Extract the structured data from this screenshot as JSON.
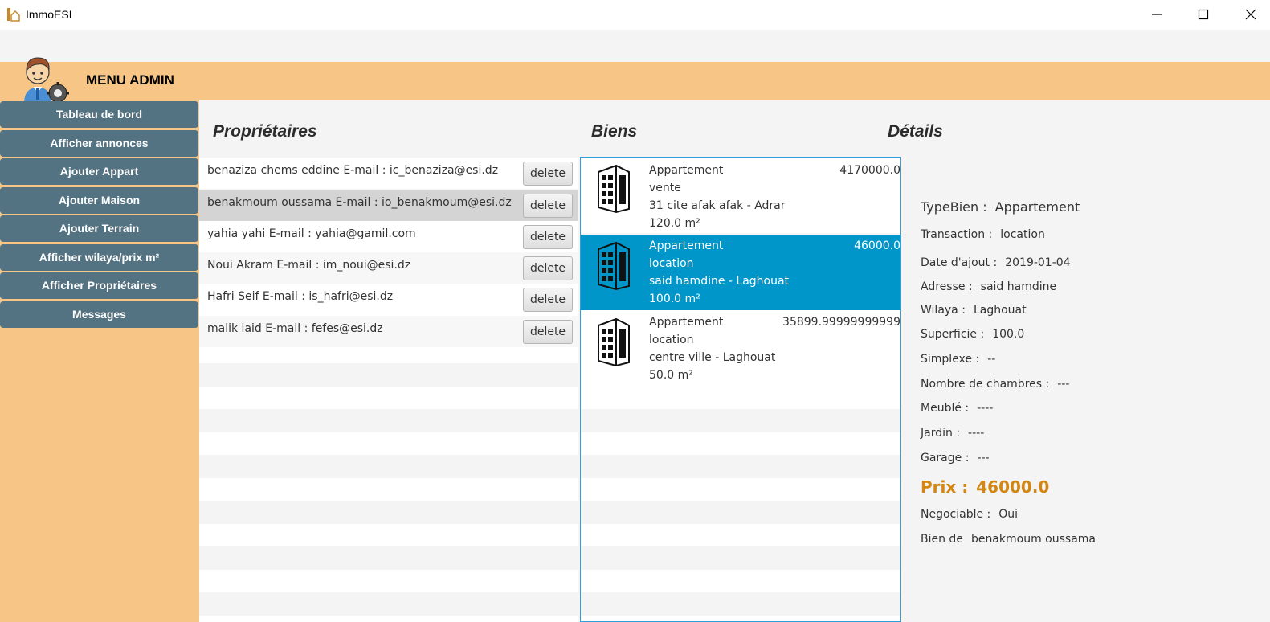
{
  "window": {
    "title": "ImmoESI"
  },
  "header": {
    "menu_title": "MENU ADMIN"
  },
  "sidebar": {
    "items": [
      {
        "label": "Tableau de bord"
      },
      {
        "label": "Afficher annonces"
      },
      {
        "label": "Ajouter Appart"
      },
      {
        "label": "Ajouter Maison"
      },
      {
        "label": "Ajouter Terrain"
      },
      {
        "label": "Afficher wilaya/prix m²"
      },
      {
        "label": "Afficher Propriétaires"
      },
      {
        "label": "Messages"
      }
    ]
  },
  "sections": {
    "owners_title": "Propriétaires",
    "goods_title": "Biens",
    "details_title": "Détails"
  },
  "owners": [
    {
      "text": "benaziza chems eddine E-mail : ic_benaziza@esi.dz",
      "delete_label": "delete"
    },
    {
      "text": "benakmoum oussama E-mail : io_benakmoum@esi.dz",
      "delete_label": "delete"
    },
    {
      "text": "yahia yahi E-mail : yahia@gamil.com",
      "delete_label": "delete"
    },
    {
      "text": "Noui Akram E-mail : im_noui@esi.dz",
      "delete_label": "delete"
    },
    {
      "text": "Hafri Seif E-mail : is_hafri@esi.dz",
      "delete_label": "delete"
    },
    {
      "text": "malik laid E-mail : fefes@esi.dz",
      "delete_label": "delete"
    }
  ],
  "goods": [
    {
      "type": "Appartement",
      "transaction": "vente",
      "address": "31 cite afak afak -  Adrar",
      "surface": "120.0 m²",
      "price": "4170000.0"
    },
    {
      "type": "Appartement",
      "transaction": "location",
      "address": "said hamdine -  Laghouat",
      "surface": "100.0 m²",
      "price": "46000.0"
    },
    {
      "type": "Appartement",
      "transaction": "location",
      "address": "centre ville -  Laghouat",
      "surface": "50.0 m²",
      "price": "35899.99999999999"
    }
  ],
  "details": {
    "typebien_label": "TypeBien :",
    "typebien_value": "Appartement",
    "transaction_label": "Transaction :",
    "transaction_value": "location",
    "date_label": "Date d'ajout :",
    "date_value": "2019-01-04",
    "adresse_label": "Adresse :",
    "adresse_value": "said hamdine",
    "wilaya_label": "Wilaya :",
    "wilaya_value": "Laghouat",
    "superficie_label": "Superficie :",
    "superficie_value": "100.0",
    "simplexe_label": "Simplexe :",
    "simplexe_value": "--",
    "chambres_label": "Nombre de chambres :",
    "chambres_value": "---",
    "meuble_label": "Meublé :",
    "meuble_value": "----",
    "jardin_label": "Jardin :",
    "jardin_value": "----",
    "garage_label": "Garage :",
    "garage_value": "---",
    "prix_label": "Prix :",
    "prix_value": "46000.0",
    "negociable_label": "Negociable :",
    "negociable_value": "Oui",
    "owner_label": "Bien de",
    "owner_value": "benakmoum  oussama"
  },
  "colors": {
    "sidebar_button": "#537282",
    "orange_background": "#f7c686",
    "selection": "#0096c9",
    "price_accent": "#d48613"
  }
}
